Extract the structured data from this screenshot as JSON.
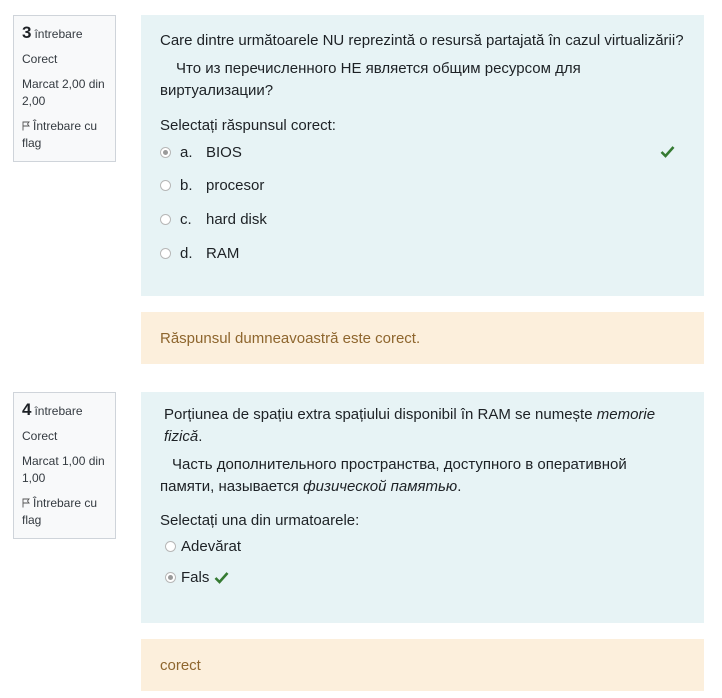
{
  "q3": {
    "info": {
      "number": "3",
      "label": "întrebare",
      "state": "Corect",
      "mark": "Marcat 2,00 din 2,00",
      "flag_label": "Întrebare cu flag"
    },
    "text_ro": "Care dintre următoarele NU reprezintă o resursă partajată în cazul virtualizării?",
    "text_ru": "Что из перечисленного НЕ является общим ресурсом для виртуализации?",
    "prompt": "Selectați răspunsul corect:",
    "options": [
      {
        "letter": "a.",
        "label": "BIOS",
        "selected": true,
        "correct": true
      },
      {
        "letter": "b.",
        "label": "procesor",
        "selected": false
      },
      {
        "letter": "c.",
        "label": "hard disk",
        "selected": false
      },
      {
        "letter": "d.",
        "label": "RAM",
        "selected": false
      }
    ],
    "feedback": "Răspunsul dumneavoastră este corect."
  },
  "q4": {
    "info": {
      "number": "4",
      "label": "întrebare",
      "state": "Corect",
      "mark": "Marcat 1,00 din 1,00",
      "flag_label": "Întrebare cu flag"
    },
    "text_ro_main": "Porțiunea de spațiu extra spațiului disponibil în RAM se numește ",
    "text_ro_em": "memorie fizică",
    "text_ro_end": ".",
    "text_ru_main": "Часть дополнительного пространства, доступного в оперативной памяти, называется ",
    "text_ru_em": "физической памятью",
    "text_ru_end": ".",
    "prompt": "Selectați una din urmatoarele:",
    "options": [
      {
        "label": "Adevărat",
        "selected": false
      },
      {
        "label": "Fals",
        "selected": true,
        "correct": true
      }
    ],
    "feedback": "corect"
  },
  "colors": {
    "question_bg": "#e7f3f5",
    "feedback_bg": "#fcefdc",
    "feedback_text": "#8e662e",
    "check": "#357a32"
  }
}
